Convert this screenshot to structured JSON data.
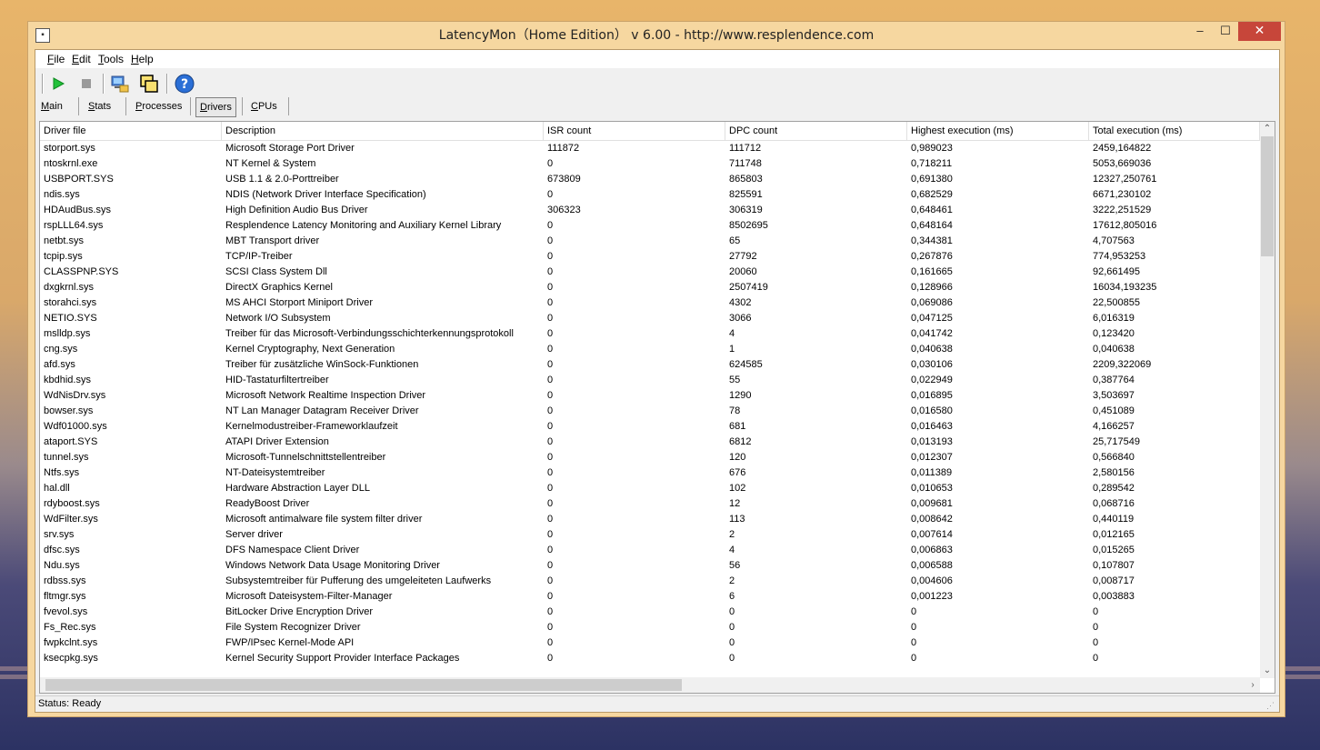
{
  "window": {
    "title": "LatencyMon（Home Edition） v 6.00 - http://www.resplendence.com",
    "min_glyph": "–",
    "max_glyph": "☐",
    "close_glyph": "✕"
  },
  "menu": [
    "File",
    "Edit",
    "Tools",
    "Help"
  ],
  "toolbar": {
    "icons": [
      "play-icon",
      "stop-icon",
      "computer-icon",
      "windows-icon",
      "help-icon"
    ]
  },
  "tabs": [
    "Main",
    "Stats",
    "Processes",
    "Drivers",
    "CPUs"
  ],
  "active_tab": "Drivers",
  "table": {
    "columns": [
      "Driver file",
      "Description",
      "ISR count",
      "DPC count",
      "Highest execution (ms)",
      "Total execution (ms)"
    ],
    "rows": [
      [
        "storport.sys",
        "Microsoft Storage Port Driver",
        "111872",
        "111712",
        "0,989023",
        "2459,164822"
      ],
      [
        "ntoskrnl.exe",
        "NT Kernel & System",
        "0",
        "711748",
        "0,718211",
        "5053,669036"
      ],
      [
        "USBPORT.SYS",
        "USB 1.1 & 2.0-Porttreiber",
        "673809",
        "865803",
        "0,691380",
        "12327,250761"
      ],
      [
        "ndis.sys",
        "NDIS (Network Driver Interface Specification)",
        "0",
        "825591",
        "0,682529",
        "6671,230102"
      ],
      [
        "HDAudBus.sys",
        "High Definition Audio Bus Driver",
        "306323",
        "306319",
        "0,648461",
        "3222,251529"
      ],
      [
        "rspLLL64.sys",
        "Resplendence Latency Monitoring and Auxiliary Kernel Library",
        "0",
        "8502695",
        "0,648164",
        "17612,805016"
      ],
      [
        "netbt.sys",
        "MBT Transport driver",
        "0",
        "65",
        "0,344381",
        "4,707563"
      ],
      [
        "tcpip.sys",
        "TCP/IP-Treiber",
        "0",
        "27792",
        "0,267876",
        "774,953253"
      ],
      [
        "CLASSPNP.SYS",
        "SCSI Class System Dll",
        "0",
        "20060",
        "0,161665",
        "92,661495"
      ],
      [
        "dxgkrnl.sys",
        "DirectX Graphics Kernel",
        "0",
        "2507419",
        "0,128966",
        "16034,193235"
      ],
      [
        "storahci.sys",
        "MS AHCI Storport Miniport Driver",
        "0",
        "4302",
        "0,069086",
        "22,500855"
      ],
      [
        "NETIO.SYS",
        "Network I/O Subsystem",
        "0",
        "3066",
        "0,047125",
        "6,016319"
      ],
      [
        "mslldp.sys",
        "Treiber für das Microsoft-Verbindungsschichterkennungsprotokoll",
        "0",
        "4",
        "0,041742",
        "0,123420"
      ],
      [
        "cng.sys",
        "Kernel Cryptography, Next Generation",
        "0",
        "1",
        "0,040638",
        "0,040638"
      ],
      [
        "afd.sys",
        "Treiber für zusätzliche WinSock-Funktionen",
        "0",
        "624585",
        "0,030106",
        "2209,322069"
      ],
      [
        "kbdhid.sys",
        "HID-Tastaturfiltertreiber",
        "0",
        "55",
        "0,022949",
        "0,387764"
      ],
      [
        "WdNisDrv.sys",
        "Microsoft Network Realtime Inspection Driver",
        "0",
        "1290",
        "0,016895",
        "3,503697"
      ],
      [
        "bowser.sys",
        "NT Lan Manager Datagram Receiver Driver",
        "0",
        "78",
        "0,016580",
        "0,451089"
      ],
      [
        "Wdf01000.sys",
        "Kernelmodustreiber-Frameworklaufzeit",
        "0",
        "681",
        "0,016463",
        "4,166257"
      ],
      [
        "ataport.SYS",
        "ATAPI Driver Extension",
        "0",
        "6812",
        "0,013193",
        "25,717549"
      ],
      [
        "tunnel.sys",
        "Microsoft-Tunnelschnittstellentreiber",
        "0",
        "120",
        "0,012307",
        "0,566840"
      ],
      [
        "Ntfs.sys",
        "NT-Dateisystemtreiber",
        "0",
        "676",
        "0,011389",
        "2,580156"
      ],
      [
        "hal.dll",
        "Hardware Abstraction Layer DLL",
        "0",
        "102",
        "0,010653",
        "0,289542"
      ],
      [
        "rdyboost.sys",
        "ReadyBoost Driver",
        "0",
        "12",
        "0,009681",
        "0,068716"
      ],
      [
        "WdFilter.sys",
        "Microsoft antimalware file system filter driver",
        "0",
        "113",
        "0,008642",
        "0,440119"
      ],
      [
        "srv.sys",
        "Server driver",
        "0",
        "2",
        "0,007614",
        "0,012165"
      ],
      [
        "dfsc.sys",
        "DFS Namespace Client Driver",
        "0",
        "4",
        "0,006863",
        "0,015265"
      ],
      [
        "Ndu.sys",
        "Windows Network Data Usage Monitoring Driver",
        "0",
        "56",
        "0,006588",
        "0,107807"
      ],
      [
        "rdbss.sys",
        "Subsystemtreiber für Pufferung des umgeleiteten Laufwerks",
        "0",
        "2",
        "0,004606",
        "0,008717"
      ],
      [
        "fltmgr.sys",
        "Microsoft Dateisystem-Filter-Manager",
        "0",
        "6",
        "0,001223",
        "0,003883"
      ],
      [
        "fvevol.sys",
        "BitLocker Drive Encryption Driver",
        "0",
        "0",
        "0",
        "0"
      ],
      [
        "Fs_Rec.sys",
        "File System Recognizer Driver",
        "0",
        "0",
        "0",
        "0"
      ],
      [
        "fwpkclnt.sys",
        "FWP/IPsec Kernel-Mode API",
        "0",
        "0",
        "0",
        "0"
      ],
      [
        "ksecpkg.sys",
        "Kernel Security Support Provider Interface Packages",
        "0",
        "0",
        "0",
        "0"
      ]
    ]
  },
  "status": "Status: Ready"
}
